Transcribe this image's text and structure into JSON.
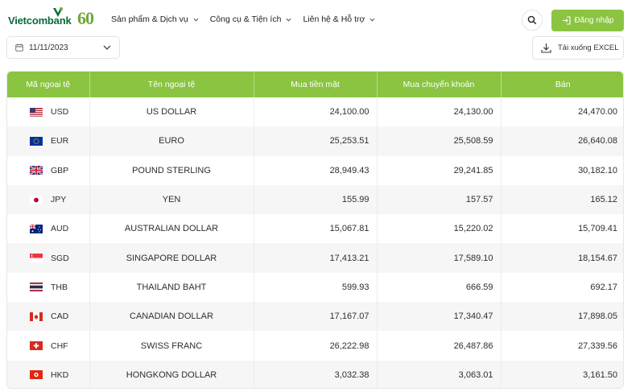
{
  "brand": {
    "name": "Vietcombank",
    "anniversary": "60"
  },
  "nav": [
    {
      "label": "Sản phẩm & Dịch vụ"
    },
    {
      "label": "Công cụ & Tiện ích"
    },
    {
      "label": "Liên hệ & Hỗ trợ"
    }
  ],
  "header": {
    "login_label": "Đăng nhập"
  },
  "toolbar": {
    "date_value": "11/11/2023",
    "excel_label": "Tải xuống EXCEL"
  },
  "table": {
    "headers": [
      "Mã ngoại tệ",
      "Tên ngoại tệ",
      "Mua tiền mặt",
      "Mua chuyển khoản",
      "Bán"
    ],
    "rows": [
      {
        "code": "USD",
        "name": "US DOLLAR",
        "cash": "24,100.00",
        "transfer": "24,130.00",
        "sell": "24,470.00",
        "flag": "us-flag-icon"
      },
      {
        "code": "EUR",
        "name": "EURO",
        "cash": "25,253.51",
        "transfer": "25,508.59",
        "sell": "26,640.08",
        "flag": "eu-flag-icon"
      },
      {
        "code": "GBP",
        "name": "POUND STERLING",
        "cash": "28,949.43",
        "transfer": "29,241.85",
        "sell": "30,182.10",
        "flag": "uk-flag-icon"
      },
      {
        "code": "JPY",
        "name": "YEN",
        "cash": "155.99",
        "transfer": "157.57",
        "sell": "165.12",
        "flag": "jp-flag-icon"
      },
      {
        "code": "AUD",
        "name": "AUSTRALIAN DOLLAR",
        "cash": "15,067.81",
        "transfer": "15,220.02",
        "sell": "15,709.41",
        "flag": "au-flag-icon"
      },
      {
        "code": "SGD",
        "name": "SINGAPORE DOLLAR",
        "cash": "17,413.21",
        "transfer": "17,589.10",
        "sell": "18,154.67",
        "flag": "sg-flag-icon"
      },
      {
        "code": "THB",
        "name": "THAILAND BAHT",
        "cash": "599.93",
        "transfer": "666.59",
        "sell": "692.17",
        "flag": "th-flag-icon"
      },
      {
        "code": "CAD",
        "name": "CANADIAN DOLLAR",
        "cash": "17,167.07",
        "transfer": "17,340.47",
        "sell": "17,898.05",
        "flag": "ca-flag-icon"
      },
      {
        "code": "CHF",
        "name": "SWISS FRANC",
        "cash": "26,222.98",
        "transfer": "26,487.86",
        "sell": "27,339.56",
        "flag": "ch-flag-icon"
      },
      {
        "code": "HKD",
        "name": "HONGKONG DOLLAR",
        "cash": "3,032.38",
        "transfer": "3,063.01",
        "sell": "3,161.50",
        "flag": "hk-flag-icon"
      }
    ]
  },
  "colors": {
    "accent": "#8ac441",
    "brand_green": "#0a6b3b"
  }
}
